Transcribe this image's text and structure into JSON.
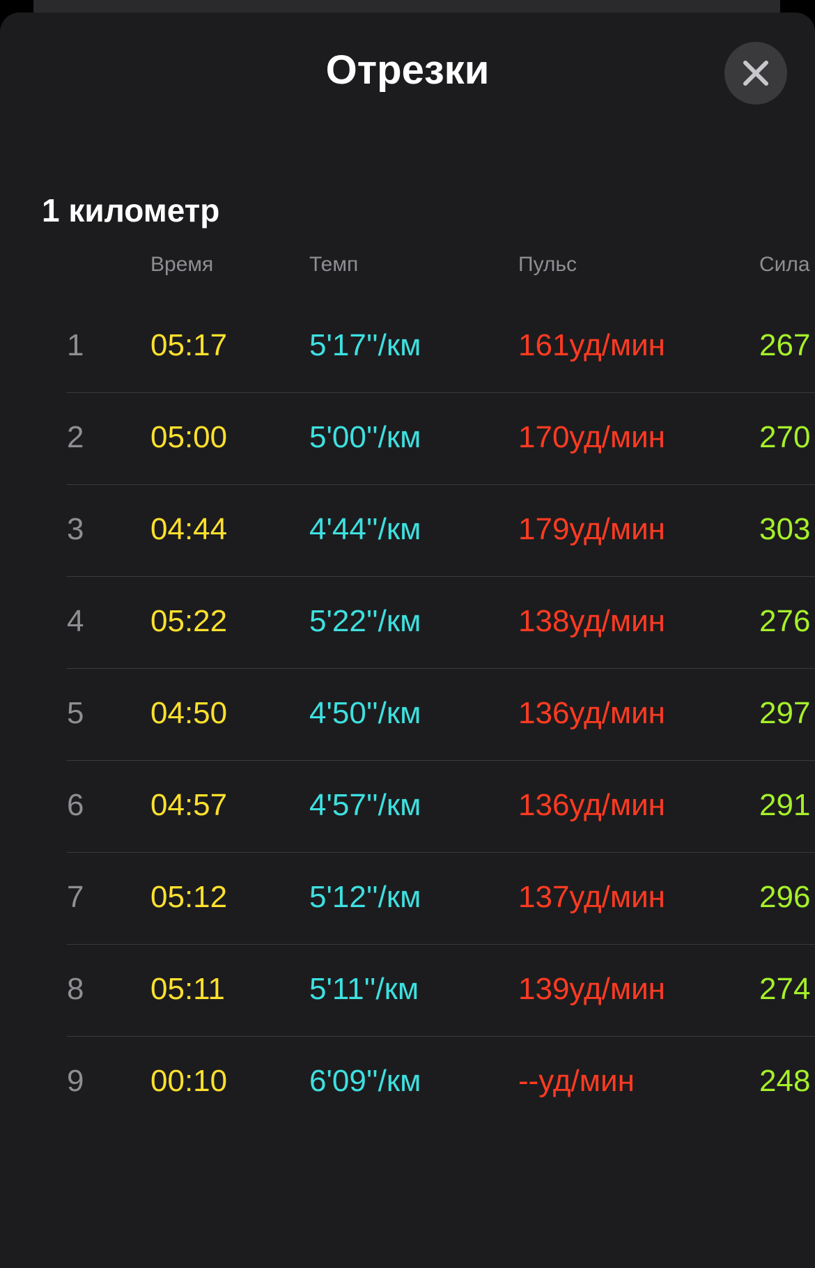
{
  "sheet": {
    "title": "Отрезки",
    "close_icon": "close-icon"
  },
  "section": {
    "title": "1 километр"
  },
  "columns": {
    "time": "Время",
    "pace": "Темп",
    "heart_rate": "Пульс",
    "power": "Сила"
  },
  "rows": [
    {
      "index": "1",
      "time": "05:17",
      "pace": "5'17''/км",
      "heart_rate": "161уд/мин",
      "power": "267"
    },
    {
      "index": "2",
      "time": "05:00",
      "pace": "5'00''/км",
      "heart_rate": "170уд/мин",
      "power": "270"
    },
    {
      "index": "3",
      "time": "04:44",
      "pace": "4'44''/км",
      "heart_rate": "179уд/мин",
      "power": "303"
    },
    {
      "index": "4",
      "time": "05:22",
      "pace": "5'22''/км",
      "heart_rate": "138уд/мин",
      "power": "276"
    },
    {
      "index": "5",
      "time": "04:50",
      "pace": "4'50''/км",
      "heart_rate": "136уд/мин",
      "power": "297"
    },
    {
      "index": "6",
      "time": "04:57",
      "pace": "4'57''/км",
      "heart_rate": "136уд/мин",
      "power": "291"
    },
    {
      "index": "7",
      "time": "05:12",
      "pace": "5'12''/км",
      "heart_rate": "137уд/мин",
      "power": "296"
    },
    {
      "index": "8",
      "time": "05:11",
      "pace": "5'11''/км",
      "heart_rate": "139уд/мин",
      "power": "274"
    },
    {
      "index": "9",
      "time": "00:10",
      "pace": "6'09''/км",
      "heart_rate": "--уд/мин",
      "power": "248"
    }
  ],
  "colors": {
    "background": "#1c1c1e",
    "time": "#ffe02e",
    "pace": "#3ee0e0",
    "heart_rate": "#ff3b22",
    "power": "#a6f02a"
  }
}
